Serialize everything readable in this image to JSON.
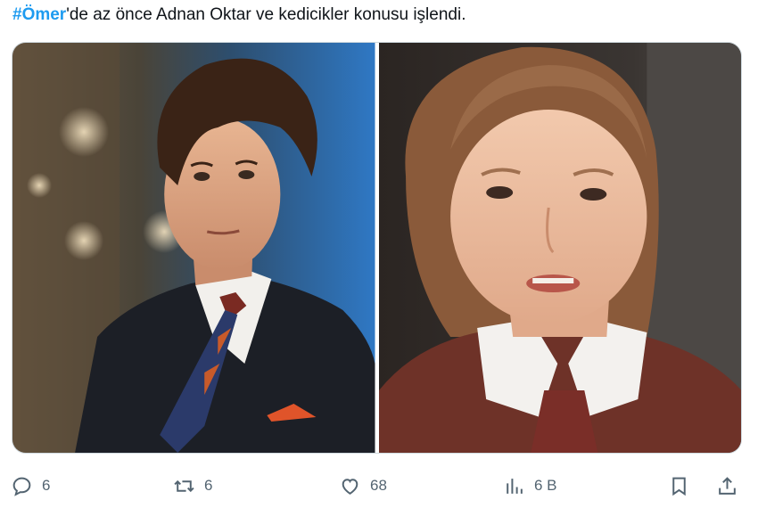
{
  "tweet": {
    "hashtag": "#Ömer",
    "text": "'de az önce Adnan Oktar ve kedicikler konusu işlendi."
  },
  "media": [
    {
      "icon": "photo-man-in-suit"
    },
    {
      "icon": "photo-girl-in-school-uniform"
    }
  ],
  "actions": {
    "reply": {
      "icon": "reply-icon",
      "count": "6"
    },
    "retweet": {
      "icon": "retweet-icon",
      "count": "6"
    },
    "like": {
      "icon": "heart-icon",
      "count": "68"
    },
    "views": {
      "icon": "views-icon",
      "count": "6 B"
    },
    "bookmark": {
      "icon": "bookmark-icon"
    },
    "share": {
      "icon": "share-icon"
    }
  },
  "colors": {
    "accent": "#1d9bf0",
    "muted": "#536471",
    "text": "#0f1419"
  }
}
